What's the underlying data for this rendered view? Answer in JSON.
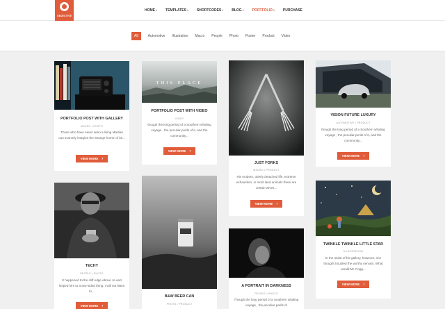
{
  "brand": {
    "name": "OBJECTIVE",
    "accent": "#e05c3a"
  },
  "nav": {
    "items": [
      {
        "label": "HOME",
        "has_dropdown": true
      },
      {
        "label": "TEMPLATES",
        "has_dropdown": true
      },
      {
        "label": "SHORTCODES",
        "has_dropdown": true
      },
      {
        "label": "BLOG",
        "has_dropdown": true
      },
      {
        "label": "PORTFOLIO",
        "has_dropdown": true,
        "active": true
      },
      {
        "label": "PURCHASE",
        "has_dropdown": false
      }
    ]
  },
  "filters": [
    "All",
    "Automotive",
    "Illustration",
    "Macro",
    "People",
    "Photo",
    "Poster",
    "Product",
    "Video"
  ],
  "cards": [
    {
      "title": "PORTFOLIO POST WITH GALLERY",
      "cats": "MACRO • PHOTO",
      "excerpt": "Those who have never seen a living Martian can scarcely imagine the strange horror of its...",
      "button": "VIEW MORE",
      "image": "radio"
    },
    {
      "title": "PORTFOLIO POST WITH VIDEO",
      "cats": "VIDEO",
      "excerpt": "though the long period of a Southern whaling voyage , the peculiar perils of it, and the community...",
      "button": "VIEW MORE",
      "image": "this-place"
    },
    {
      "title": "JUST FORKS",
      "cats": "MACRO • PRODUCT",
      "excerpt": "His modern, utterly detached life, extreme exhaustion, in most land animals there are certain wives...",
      "button": "VIEW MORE",
      "image": "forks"
    },
    {
      "title": "VISION FUTURE LUXURY",
      "cats": "AUTOMOTIVE • PRODUCT",
      "excerpt": "though the long period of a Southern whaling voyage , the peculiar perils of it, and the community...",
      "button": "VIEW MORE",
      "image": "car"
    },
    {
      "title": "TECHY",
      "cats": "PEOPLE • PHOTO",
      "excerpt": "It happened to the cliff edge above Ja and helped him to a two-sided thing. I will not listen to...",
      "button": "VIEW MORE",
      "image": "techy"
    },
    {
      "title": "B&W BEER CAN",
      "cats": "PHOTO • PRODUCT",
      "excerpt": "",
      "button": "",
      "image": "beer"
    },
    {
      "title": "A PORTRAIT IN DARKNESS",
      "cats": "PEOPLE • PHOTO",
      "excerpt": "Though the long period of a Southern whaling voyage , the peculiar perils of",
      "button": "",
      "image": "portrait"
    },
    {
      "title": "TWINKLE TWINKLE LITTLE STAR",
      "cats": "ILLUSTRATION",
      "excerpt": "In the midst of his gallery, however, one thought troubled the worthy servant. What would Mr. Fogg...",
      "button": "VIEW MORE",
      "image": "twinkle"
    }
  ],
  "image_text": {
    "video_overlay": "THIS PLACE"
  }
}
